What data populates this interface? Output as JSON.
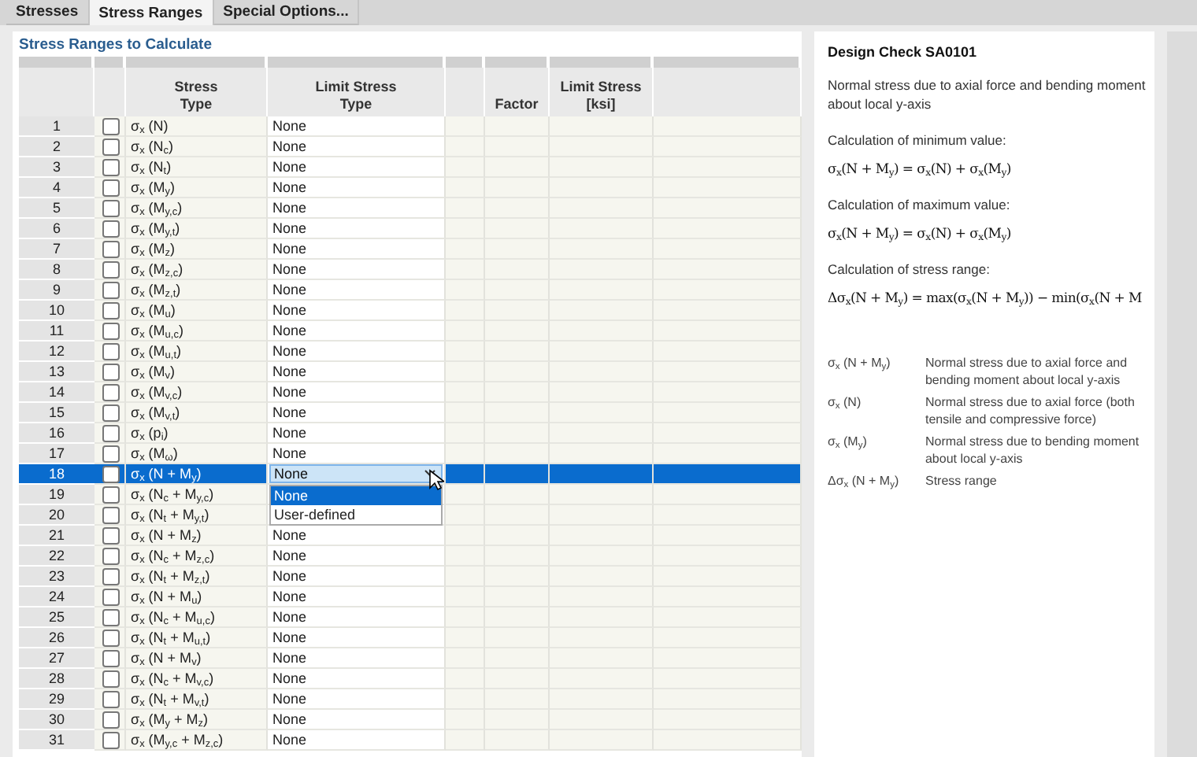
{
  "tabs": [
    {
      "label": "Stresses",
      "selected": false
    },
    {
      "label": "Stress Ranges",
      "selected": true
    },
    {
      "label": "Special Options...",
      "selected": false
    }
  ],
  "section_title": "Stress Ranges to Calculate",
  "table": {
    "columns": [
      {},
      {},
      {
        "label": "Stress",
        "sub": "Type"
      },
      {
        "label": "Limit Stress",
        "sub": "Type"
      },
      {},
      {
        "sub": "Factor"
      },
      {
        "label": "Limit Stress",
        "sub": "[ksi]"
      },
      {}
    ],
    "rows": [
      {
        "number": "1",
        "checked": false,
        "selected": false,
        "stress_type": "σ$_{x}$ (N)",
        "limit_stress_type": "None"
      },
      {
        "number": "2",
        "checked": false,
        "selected": false,
        "stress_type": "σ$_{x}$ (N$_{c}$)",
        "limit_stress_type": "None"
      },
      {
        "number": "3",
        "checked": false,
        "selected": false,
        "stress_type": "σ$_{x}$ (N$_{t}$)",
        "limit_stress_type": "None"
      },
      {
        "number": "4",
        "checked": false,
        "selected": false,
        "stress_type": "σ$_{x}$ (M$_{y}$)",
        "limit_stress_type": "None"
      },
      {
        "number": "5",
        "checked": false,
        "selected": false,
        "stress_type": "σ$_{x}$ (M$_{y,c}$)",
        "limit_stress_type": "None"
      },
      {
        "number": "6",
        "checked": false,
        "selected": false,
        "stress_type": "σ$_{x}$ (M$_{y,t}$)",
        "limit_stress_type": "None"
      },
      {
        "number": "7",
        "checked": false,
        "selected": false,
        "stress_type": "σ$_{x}$ (M$_{z}$)",
        "limit_stress_type": "None"
      },
      {
        "number": "8",
        "checked": false,
        "selected": false,
        "stress_type": "σ$_{x}$ (M$_{z,c}$)",
        "limit_stress_type": "None"
      },
      {
        "number": "9",
        "checked": false,
        "selected": false,
        "stress_type": "σ$_{x}$ (M$_{z,t}$)",
        "limit_stress_type": "None"
      },
      {
        "number": "10",
        "checked": false,
        "selected": false,
        "stress_type": "σ$_{x}$ (M$_{u}$)",
        "limit_stress_type": "None"
      },
      {
        "number": "11",
        "checked": false,
        "selected": false,
        "stress_type": "σ$_{x}$ (M$_{u,c}$)",
        "limit_stress_type": "None"
      },
      {
        "number": "12",
        "checked": false,
        "selected": false,
        "stress_type": "σ$_{x}$ (M$_{u,t}$)",
        "limit_stress_type": "None"
      },
      {
        "number": "13",
        "checked": false,
        "selected": false,
        "stress_type": "σ$_{x}$ (M$_{v}$)",
        "limit_stress_type": "None"
      },
      {
        "number": "14",
        "checked": false,
        "selected": false,
        "stress_type": "σ$_{x}$ (M$_{v,c}$)",
        "limit_stress_type": "None"
      },
      {
        "number": "15",
        "checked": false,
        "selected": false,
        "stress_type": "σ$_{x}$ (M$_{v,t}$)",
        "limit_stress_type": "None"
      },
      {
        "number": "16",
        "checked": false,
        "selected": false,
        "stress_type": "σ$_{x}$ (p$_{i}$)",
        "limit_stress_type": "None"
      },
      {
        "number": "17",
        "checked": false,
        "selected": false,
        "stress_type": "σ$_{x}$ (M$_{ω}$)",
        "limit_stress_type": "None"
      },
      {
        "number": "18",
        "checked": false,
        "selected": true,
        "stress_type": "σ$_{x}$ (N + M$_{y}$)",
        "limit_stress_type": "None",
        "dropdown": [
          {
            "label": "None",
            "selected": true
          },
          {
            "label": "User-defined",
            "selected": false
          }
        ]
      },
      {
        "number": "19",
        "checked": false,
        "selected": false,
        "stress_type": "σ$_{x}$ (N$_{c}$ + M$_{y,c}$)"
      },
      {
        "number": "20",
        "checked": false,
        "selected": false,
        "stress_type": "σ$_{x}$ (N$_{t}$ + M$_{y,t}$)"
      },
      {
        "number": "21",
        "checked": false,
        "selected": false,
        "stress_type": "σ$_{x}$ (N + M$_{z}$)",
        "limit_stress_type": "None"
      },
      {
        "number": "22",
        "checked": false,
        "selected": false,
        "stress_type": "σ$_{x}$ (N$_{c}$ + M$_{z,c}$)",
        "limit_stress_type": "None"
      },
      {
        "number": "23",
        "checked": false,
        "selected": false,
        "stress_type": "σ$_{x}$ (N$_{t}$ + M$_{z,t}$)",
        "limit_stress_type": "None"
      },
      {
        "number": "24",
        "checked": false,
        "selected": false,
        "stress_type": "σ$_{x}$ (N + M$_{u}$)",
        "limit_stress_type": "None"
      },
      {
        "number": "25",
        "checked": false,
        "selected": false,
        "stress_type": "σ$_{x}$ (N$_{c}$ + M$_{u,c}$)",
        "limit_stress_type": "None"
      },
      {
        "number": "26",
        "checked": false,
        "selected": false,
        "stress_type": "σ$_{x}$ (N$_{t}$ + M$_{u,t}$)",
        "limit_stress_type": "None"
      },
      {
        "number": "27",
        "checked": false,
        "selected": false,
        "stress_type": "σ$_{x}$ (N + M$_{v}$)",
        "limit_stress_type": "None"
      },
      {
        "number": "28",
        "checked": false,
        "selected": false,
        "stress_type": "σ$_{x}$ (N$_{c}$ + M$_{v,c}$)",
        "limit_stress_type": "None"
      },
      {
        "number": "29",
        "checked": false,
        "selected": false,
        "stress_type": "σ$_{x}$ (N$_{t}$ + M$_{v,t}$)",
        "limit_stress_type": "None"
      },
      {
        "number": "30",
        "checked": false,
        "selected": false,
        "stress_type": "σ$_{x}$ (M$_{y}$ + M$_{z}$)",
        "limit_stress_type": "None"
      },
      {
        "number": "31",
        "checked": false,
        "selected": false,
        "stress_type": "σ$_{x}$ (M$_{y,c}$ + M$_{z,c}$)",
        "limit_stress_type": "None"
      }
    ]
  },
  "info": {
    "title": "Design Check SA0101",
    "description": "Normal stress due to axial force and bending moment about local y-axis",
    "blocks": [
      {
        "label": "Calculation of minimum value:",
        "formula": "σ$_{x}$(N + M$_{y}$) = σ$_{x}$(N) + σ$_{x}$(M$_{y}$)"
      },
      {
        "label": "Calculation of maximum value:",
        "formula": "σ$_{x}$(N + M$_{y}$) = σ$_{x}$(N) + σ$_{x}$(M$_{y}$)"
      },
      {
        "label": "Calculation of stress range:",
        "formula": "Δσ$_{x}$(N + M$_{y}$) = max(σ$_{x}$(N + M$_{y}$)) − min(σ$_{x}$(N + M"
      }
    ],
    "legend": [
      {
        "symbol": "σ$_{x}$ (N + M$_{y}$)",
        "text": "Normal stress due to axial force and bending moment about local y-axis"
      },
      {
        "symbol": "σ$_{x}$ (N)",
        "text": "Normal stress due to axial force (both tensile and compressive force)"
      },
      {
        "symbol": "σ$_{x}$ (M$_{y}$)",
        "text": "Normal stress due to bending moment about local y-axis"
      },
      {
        "symbol": "Δσ$_{x}$ (N + M$_{y}$)",
        "text": "Stress range"
      }
    ]
  }
}
